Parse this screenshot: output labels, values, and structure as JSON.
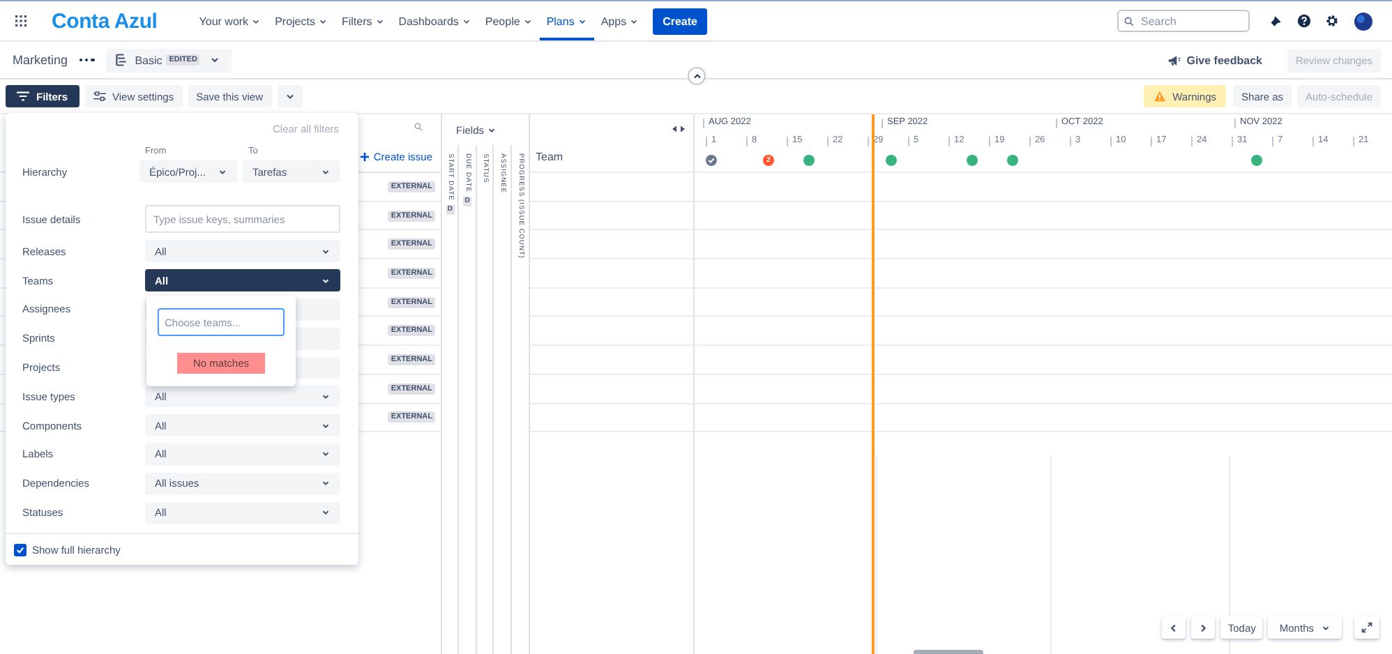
{
  "app": {
    "logo": "Conta Azul",
    "nav": [
      {
        "label": "Your work",
        "selected": false
      },
      {
        "label": "Projects",
        "selected": false
      },
      {
        "label": "Filters",
        "selected": false
      },
      {
        "label": "Dashboards",
        "selected": false
      },
      {
        "label": "People",
        "selected": false
      },
      {
        "label": "Plans",
        "selected": true
      },
      {
        "label": "Apps",
        "selected": false
      }
    ],
    "create": "Create",
    "search_placeholder": "Search"
  },
  "plan": {
    "name": "Marketing",
    "view": "Basic",
    "view_badge": "EDITED",
    "feedback": "Give feedback",
    "review": {
      "label": "Review changes",
      "disabled": true
    }
  },
  "toolbar": {
    "filters": "Filters",
    "view_settings": "View settings",
    "save_view": "Save this view",
    "warnings": "Warnings",
    "share": "Share as",
    "auto_schedule": {
      "label": "Auto-schedule",
      "disabled": true
    }
  },
  "filters_panel": {
    "clear": "Clear all filters",
    "from_label": "From",
    "to_label": "To",
    "rows": [
      {
        "label": "Hierarchy",
        "kind": "range",
        "from": "Épico/Proj...",
        "to": "Tarefas"
      },
      {
        "label": "Issue details",
        "kind": "text",
        "placeholder": "Type issue keys, summaries"
      },
      {
        "label": "Releases",
        "kind": "select",
        "value": "All",
        "active": false
      },
      {
        "label": "Teams",
        "kind": "select",
        "value": "All",
        "active": true
      },
      {
        "label": "Assignees",
        "kind": "select",
        "active": false
      },
      {
        "label": "Sprints",
        "kind": "select",
        "active": false
      },
      {
        "label": "Projects",
        "kind": "select",
        "active": false
      },
      {
        "label": "Issue types",
        "kind": "select",
        "value": "All",
        "active": false
      },
      {
        "label": "Components",
        "kind": "select",
        "value": "All",
        "active": false
      },
      {
        "label": "Labels",
        "kind": "select",
        "value": "All",
        "active": false
      },
      {
        "label": "Dependencies",
        "kind": "select",
        "value": "All issues",
        "active": false
      },
      {
        "label": "Statuses",
        "kind": "select",
        "value": "All",
        "active": false
      }
    ],
    "show_full_hierarchy": {
      "label": "Show full hierarchy",
      "checked": true
    }
  },
  "teams_popup": {
    "placeholder": "Choose teams...",
    "message": "No matches"
  },
  "issues": {
    "create": "Create issue",
    "rows": [
      {
        "badge": "EXTERNAL"
      },
      {
        "badge": "EXTERNAL"
      },
      {
        "badge": "EXTERNAL"
      },
      {
        "badge": "EXTERNAL"
      },
      {
        "badge": "EXTERNAL"
      },
      {
        "badge": "EXTERNAL"
      },
      {
        "badge": "EXTERNAL"
      },
      {
        "badge": "EXTERNAL"
      },
      {
        "badge": "EXTERNAL"
      }
    ]
  },
  "fields": {
    "label": "Fields",
    "columns": [
      {
        "label": "START DATE",
        "badge": "D"
      },
      {
        "label": "DUE DATE",
        "badge": "D"
      },
      {
        "label": "STATUS"
      },
      {
        "label": "ASSIGNEE"
      },
      {
        "label": "PROGRESS (ISSUE COUNT)"
      }
    ]
  },
  "team_column": {
    "label": "Team"
  },
  "timeline": {
    "months": [
      "AUG 2022",
      "SEP 2022",
      "OCT 2022",
      "NOV 2022"
    ],
    "weeks": [
      "1",
      "8",
      "15",
      "22",
      "29",
      "5",
      "12",
      "19",
      "26",
      "3",
      "10",
      "17",
      "24",
      "31",
      "7",
      "14",
      "21"
    ],
    "milestones": [
      {
        "kind": "done",
        "color": "#6b778c"
      },
      {
        "kind": "count",
        "color": "#ff5630",
        "count": "2"
      },
      {
        "kind": "plain",
        "color": "#36b37e"
      },
      {
        "kind": "plain",
        "color": "#36b37e"
      },
      {
        "kind": "plain",
        "color": "#36b37e"
      },
      {
        "kind": "plain",
        "color": "#36b37e"
      },
      {
        "kind": "plain",
        "color": "#36b37e"
      }
    ]
  },
  "footer_controls": {
    "today": "Today",
    "scale": "Months"
  }
}
